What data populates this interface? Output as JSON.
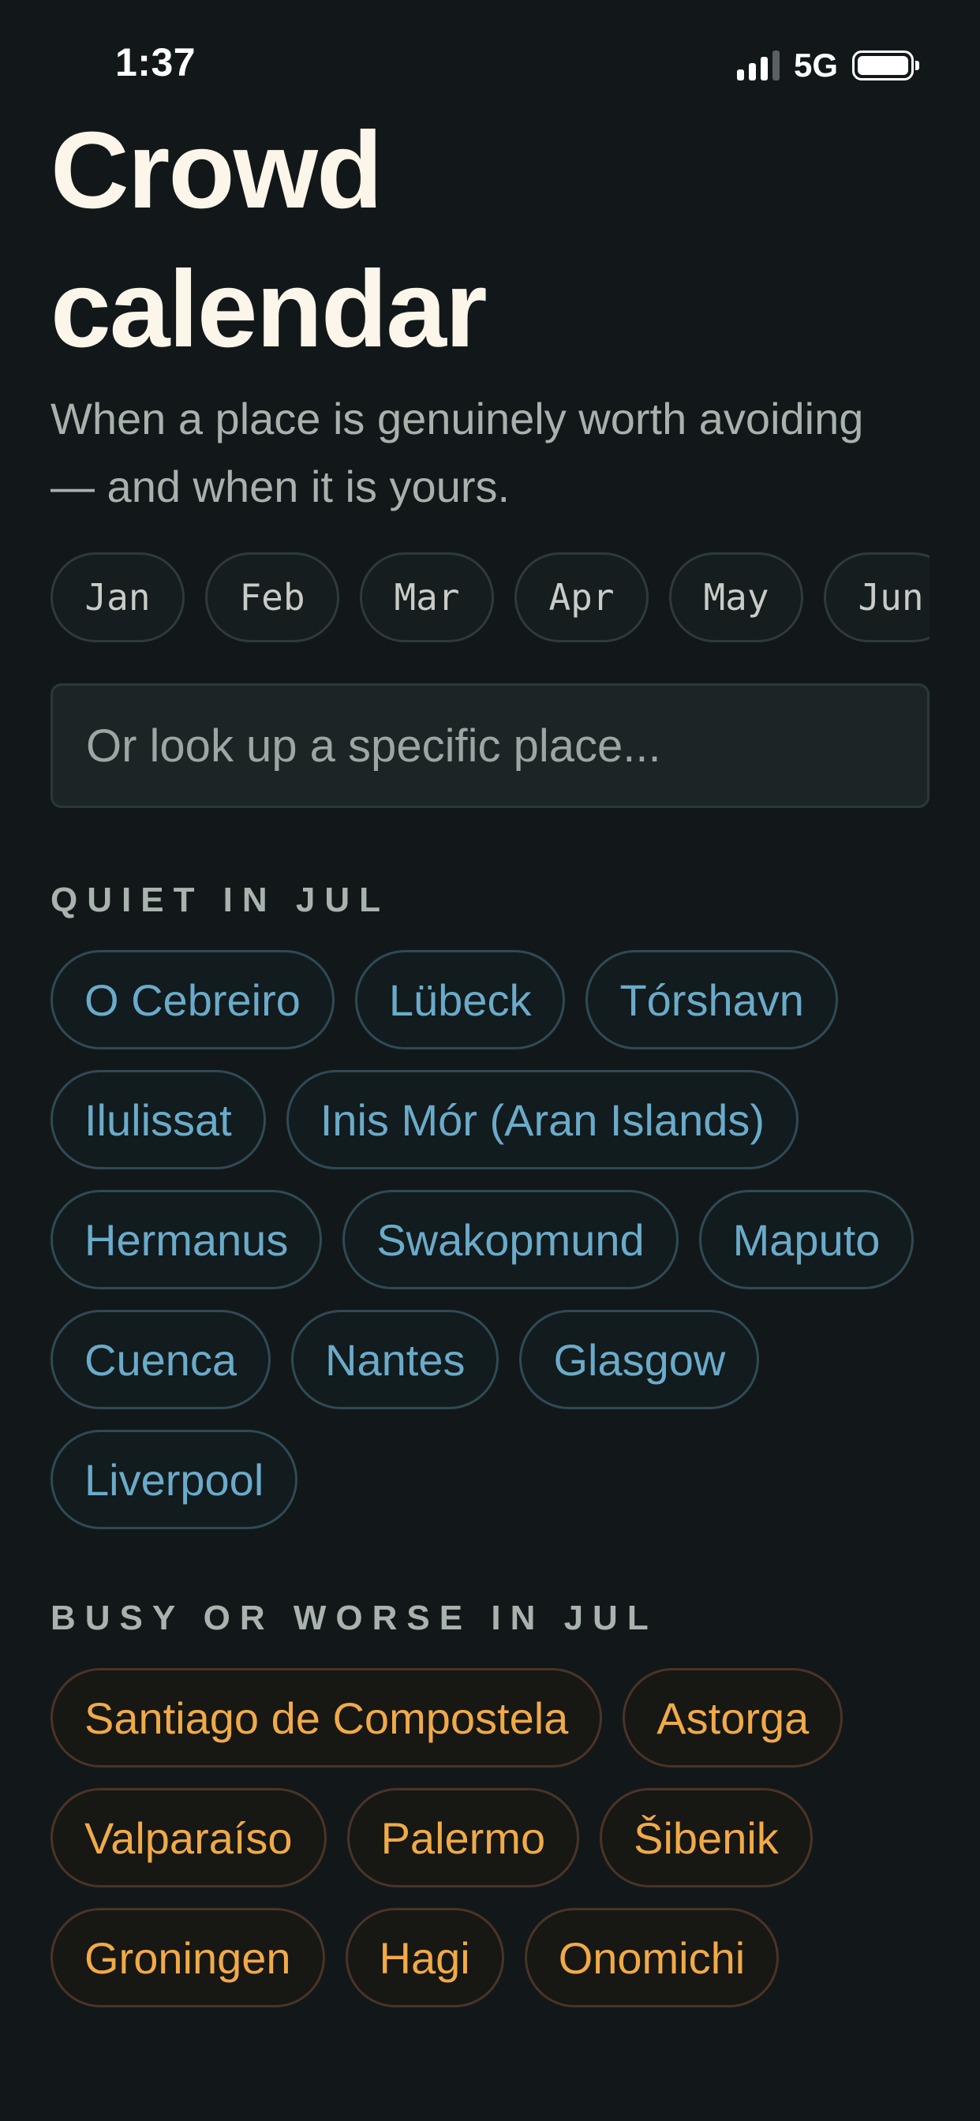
{
  "status_bar": {
    "time": "1:37",
    "network": "5G",
    "signal_bars": 3,
    "signal_bars_total": 4
  },
  "header": {
    "title_line1": "Crowd",
    "title_line2": "calendar",
    "subtitle": "When a place is genuinely worth avoiding — and when it is yours."
  },
  "months": [
    "Jan",
    "Feb",
    "Mar",
    "Apr",
    "May",
    "Jun"
  ],
  "search": {
    "placeholder": "Or look up a specific place..."
  },
  "quiet": {
    "heading": "QUIET IN JUL",
    "places": [
      "O Cebreiro",
      "Lübeck",
      "Tórshavn",
      "Ilulissat",
      "Inis Mór (Aran Islands)",
      "Hermanus",
      "Swakopmund",
      "Maputo",
      "Cuenca",
      "Nantes",
      "Glasgow",
      "Liverpool"
    ]
  },
  "busy": {
    "heading": "BUSY OR WORSE IN JUL",
    "places": [
      "Santiago de Compostela",
      "Astorga",
      "Valparaíso",
      "Palermo",
      "Šibenik",
      "Groningen",
      "Hagi",
      "Onomichi"
    ]
  },
  "colors": {
    "background": "#121819",
    "title": "#fbf5ea",
    "muted_text": "#a8b1ac",
    "quiet_accent": "#6aabc9",
    "busy_accent": "#f0aa47"
  }
}
